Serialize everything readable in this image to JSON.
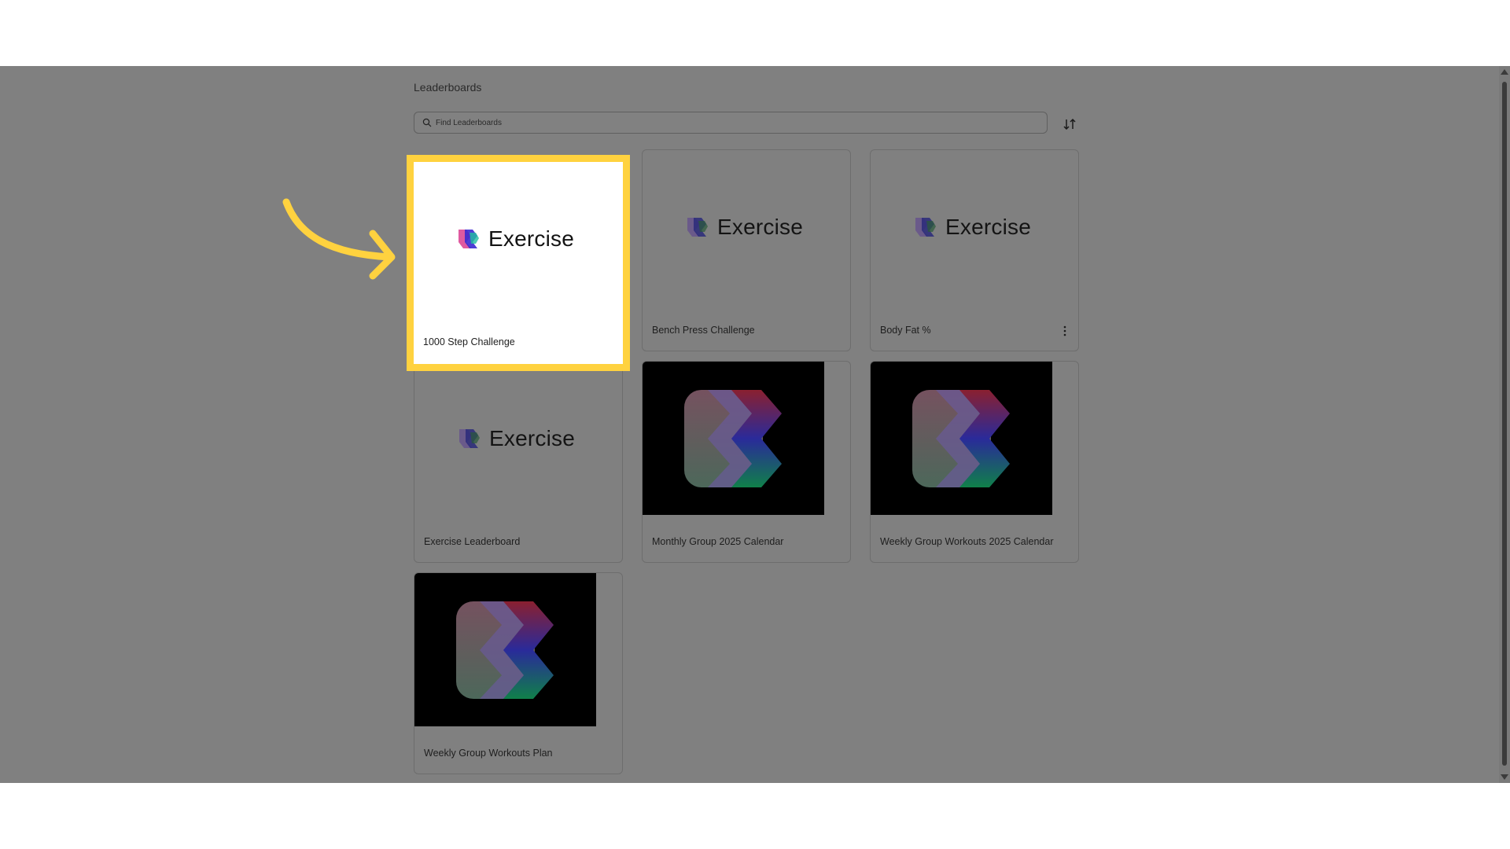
{
  "page": {
    "title": "Leaderboards"
  },
  "search": {
    "placeholder": "Find Leaderboards"
  },
  "sort": {
    "icon": "sort-icon"
  },
  "cards": [
    {
      "title": "1000 Step Challenge",
      "thumbnail": "Exercise",
      "highlighted": true
    },
    {
      "title": "Bench Press Challenge",
      "thumbnail": "Exercise"
    },
    {
      "title": "Body Fat %",
      "thumbnail": "Exercise",
      "menu_icon": "more-vertical-icon"
    },
    {
      "title": "Exercise Leaderboard",
      "thumbnail": "Exercise"
    },
    {
      "title": "Monthly Group 2025 Calendar",
      "thumbnail": "logo-dark"
    },
    {
      "title": "Weekly Group Workouts 2025 Calendar",
      "thumbnail": "logo-dark"
    },
    {
      "title": "Weekly Group Workouts Plan",
      "thumbnail": "logo-dark"
    }
  ],
  "colors": {
    "highlight": "#ffd23f",
    "overlay": "#808080"
  }
}
